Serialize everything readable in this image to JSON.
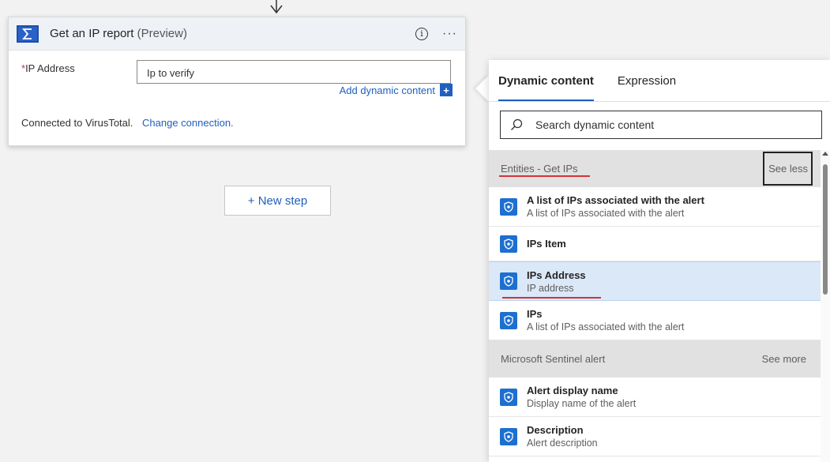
{
  "action_card": {
    "title": "Get an IP report",
    "title_suffix": "(Preview)",
    "field_label": "IP Address",
    "required_marker": "*",
    "field_value": "Ip to verify",
    "add_dynamic_label": "Add dynamic content",
    "add_dynamic_icon": "+",
    "connection_text": "Connected to VirusTotal.",
    "change_connection_label": "Change connection.",
    "more_label": "···",
    "info_label": "i"
  },
  "new_step_label": "+ New step",
  "dynamic_panel": {
    "tabs": [
      {
        "label": "Dynamic content",
        "active": true
      },
      {
        "label": "Expression",
        "active": false
      }
    ],
    "search_placeholder": "Search dynamic content",
    "groups": [
      {
        "name": "Entities - Get IPs",
        "toggle_label": "See less",
        "items": [
          {
            "title": "A list of IPs associated with the alert",
            "subtitle": "A list of IPs associated with the alert"
          },
          {
            "title": "IPs Item",
            "subtitle": ""
          },
          {
            "title": "IPs Address",
            "subtitle": "IP address",
            "selected": true
          },
          {
            "title": "IPs",
            "subtitle": "A list of IPs associated with the alert"
          }
        ]
      },
      {
        "name": "Microsoft Sentinel alert",
        "toggle_label": "See more",
        "items": [
          {
            "title": "Alert display name",
            "subtitle": "Display name of the alert"
          },
          {
            "title": "Description",
            "subtitle": "Alert description"
          }
        ]
      }
    ]
  },
  "colors": {
    "accent": "#1f5fbf",
    "item_icon": "#1d6fd1",
    "selected_row": "#dbe8f8",
    "highlight_underline": "#d13438"
  },
  "icons": {
    "card_icon": "sigma-icon",
    "item_icon": "shield-eye-icon",
    "search_icon": "search-icon"
  }
}
